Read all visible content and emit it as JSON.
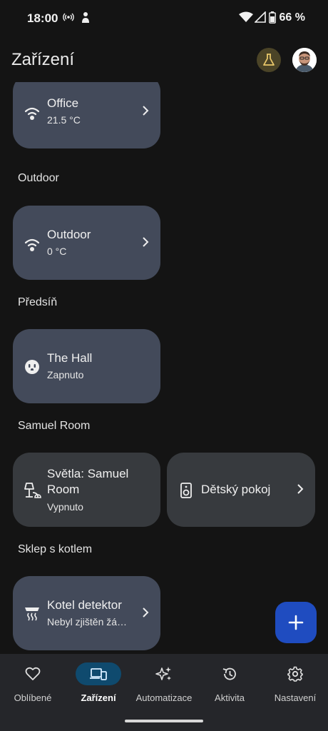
{
  "status_bar": {
    "time": "18:00",
    "battery": "66 %",
    "icons": [
      "hotspot-icon",
      "person-pin-icon",
      "wifi-icon",
      "cell-signal-icon",
      "battery-icon"
    ]
  },
  "header": {
    "title": "Zařízení",
    "labs_icon": "flask-icon",
    "avatar_icon": "avatar"
  },
  "sections": [
    {
      "heading": "",
      "cards": [
        {
          "title": "Office",
          "subtitle": "21.5 °C",
          "icon": "wifi-point-icon",
          "state": "on",
          "chevron": true
        }
      ]
    },
    {
      "heading": "Outdoor",
      "cards": [
        {
          "title": "Outdoor",
          "subtitle": "0 °C",
          "icon": "wifi-point-icon",
          "state": "on",
          "chevron": true
        }
      ]
    },
    {
      "heading": "Předsíň",
      "cards": [
        {
          "title": "The Hall",
          "subtitle": "Zapnuto",
          "icon": "outlet-icon",
          "state": "on",
          "chevron": false
        }
      ]
    },
    {
      "heading": "Samuel Room",
      "cards": [
        {
          "title": "Světla: Samuel Room",
          "subtitle": "Vypnuto",
          "icon": "lamp-icon",
          "state": "off",
          "chevron": false
        },
        {
          "title": "Dětský pokoj",
          "subtitle": "",
          "icon": "speaker-icon",
          "state": "off",
          "chevron": true
        }
      ]
    },
    {
      "heading": "Sklep s kotlem",
      "cards": [
        {
          "title": "Kotel detektor",
          "subtitle": "Nebyl zjištěn žá…",
          "icon": "smoke-detector-icon",
          "state": "on",
          "chevron": true
        }
      ]
    }
  ],
  "fab": {
    "icon": "plus-icon"
  },
  "bottom_nav": {
    "items": [
      {
        "label": "Oblíbené",
        "icon": "heart-icon",
        "active": false
      },
      {
        "label": "Zařízení",
        "icon": "devices-icon",
        "active": true
      },
      {
        "label": "Automatizace",
        "icon": "sparkle-icon",
        "active": false
      },
      {
        "label": "Aktivita",
        "icon": "history-icon",
        "active": false
      },
      {
        "label": "Nastavení",
        "icon": "gear-icon",
        "active": false
      }
    ]
  },
  "colors": {
    "background": "#141414",
    "card_on": "#434a5a",
    "card_off": "#373a3e",
    "fab": "#1f4cc0",
    "nav_active_pill": "#0f4a6e",
    "labs_button": "#4b4427"
  }
}
